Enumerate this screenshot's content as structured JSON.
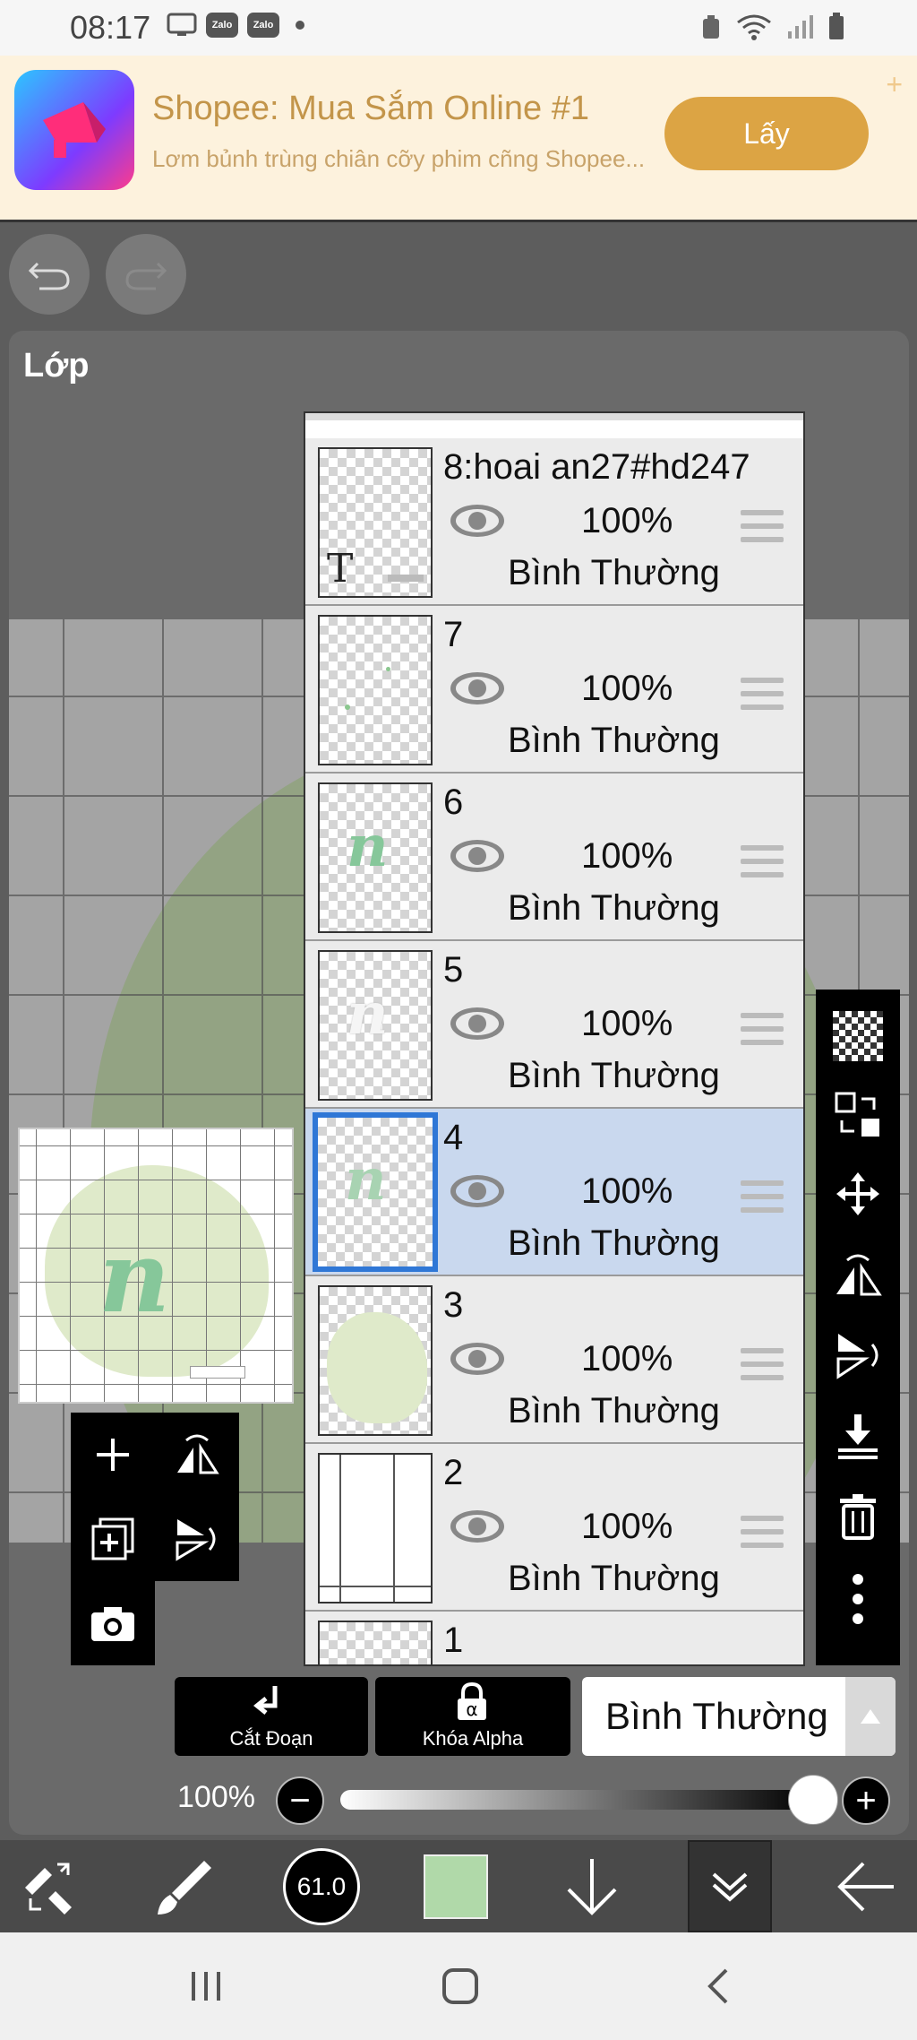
{
  "status_bar": {
    "time": "08:17",
    "notification_icons": [
      "tv-icon",
      "zalo-icon",
      "zalo-icon",
      "dot-icon"
    ],
    "zalo_label": "Zalo",
    "right_icons": [
      "recycle-icon",
      "wifi-icon",
      "signal-icon",
      "battery-icon"
    ]
  },
  "ad": {
    "title": "Shopee: Mua Sắm Online #1",
    "description": "Lơm bủnh trùng chiân cỡy phim cñng Shopee...",
    "cta_label": "Lấy",
    "icon": "megaphone-icon"
  },
  "history": {
    "undo_icon": "undo-icon",
    "redo_icon": "redo-icon"
  },
  "panel": {
    "title": "Lớp"
  },
  "layers": [
    {
      "name": "8:hoai an27#hd247",
      "opacity": "100%",
      "blend": "Bình Thường",
      "selected": false,
      "thumb": "text"
    },
    {
      "name": "7",
      "opacity": "100%",
      "blend": "Bình Thường",
      "selected": false,
      "thumb": "dots"
    },
    {
      "name": "6",
      "opacity": "100%",
      "blend": "Bình Thường",
      "selected": false,
      "thumb": "letter-green"
    },
    {
      "name": "5",
      "opacity": "100%",
      "blend": "Bình Thường",
      "selected": false,
      "thumb": "letter-white"
    },
    {
      "name": "4",
      "opacity": "100%",
      "blend": "Bình Thường",
      "selected": true,
      "thumb": "letter-green"
    },
    {
      "name": "3",
      "opacity": "100%",
      "blend": "Bình Thường",
      "selected": false,
      "thumb": "blob"
    },
    {
      "name": "2",
      "opacity": "100%",
      "blend": "Bình Thường",
      "selected": false,
      "thumb": "grid"
    },
    {
      "name": "1",
      "opacity": "",
      "blend": "",
      "selected": false,
      "thumb": "empty"
    }
  ],
  "thumb_text": {
    "letter": "n",
    "text_tool": "T"
  },
  "right_tools": [
    "checker-icon",
    "swap-layer-icon",
    "move-icon",
    "flip-horizontal-icon",
    "flip-vertical-icon",
    "merge-down-icon",
    "trash-icon",
    "more-icon"
  ],
  "left_tools": [
    "add-layer-icon",
    "flip-layer-icon",
    "duplicate-layer-icon",
    "flip-vertical-layer-icon",
    "camera-icon"
  ],
  "actions": {
    "clip_label": "Cắt Đoạn",
    "alpha_lock_label": "Khóa Alpha",
    "blend_mode": "Bình Thường"
  },
  "opacity": {
    "label": "100%",
    "value": 1.0,
    "minus": "−",
    "plus": "+"
  },
  "bottom_toolbar": {
    "brush_size": "61.0",
    "color": "#b0d9a9",
    "tools": [
      "transform-icon",
      "brush-icon",
      "brush-size",
      "color-swatch",
      "arrow-down-icon",
      "layer-collapse-icon",
      "back-arrow-icon"
    ]
  },
  "colors": {
    "accent_selected": "#2f77d6",
    "selected_row": "#c9d8ee",
    "ad_button": "#dca444"
  }
}
